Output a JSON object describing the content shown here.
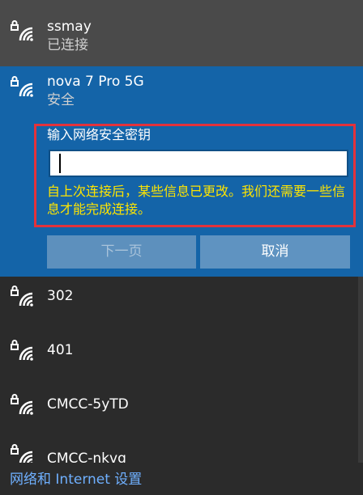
{
  "networks": {
    "connected": {
      "name": "ssmay",
      "status": "已连接"
    },
    "selected": {
      "name": "nova 7 Pro 5G",
      "status": "安全",
      "key_label": "输入网络安全密钥",
      "key_value": "",
      "warning": "自上次连接后，某些信息已更改。我们还需要一些信息才能完成连接。",
      "next_label": "下一页",
      "cancel_label": "取消"
    },
    "others": [
      {
        "name": "302"
      },
      {
        "name": "401"
      },
      {
        "name": "CMCC-5yTD"
      },
      {
        "name": "CMCC-nkvg"
      }
    ]
  },
  "footer": {
    "settings_link": "网络和 Internet 设置"
  },
  "colors": {
    "panel": "#2b2b2b",
    "connected_row": "#4a4a4a",
    "selected_row": "#1464a8",
    "highlight_box": "#e4323b",
    "warning_text": "#ffe500",
    "link": "#6fb0ff"
  },
  "icons": {
    "network": "wifi-secured-icon"
  }
}
